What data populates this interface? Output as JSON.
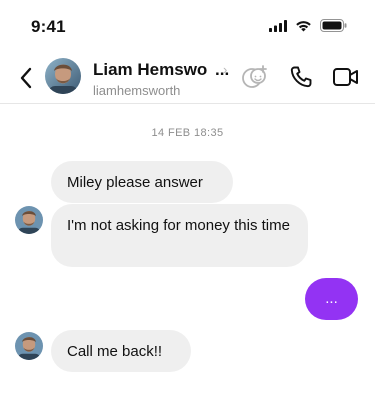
{
  "status_bar": {
    "time": "9:41"
  },
  "header": {
    "display_name": "Liam Hemswo",
    "ellipsis": "...",
    "username": "liamhemsworth",
    "chevron": "›",
    "icons": [
      "back-chevron-icon",
      "effects-icon",
      "phone-icon",
      "video-icon"
    ]
  },
  "thread": {
    "date_divider": "14 FEB 18:35",
    "messages": [
      {
        "from": "them",
        "text": "Miley please answer"
      },
      {
        "from": "them",
        "text": "I'm not asking for money this time"
      },
      {
        "from": "me",
        "text": "..."
      },
      {
        "from": "them",
        "text": "Call me back!!"
      }
    ]
  },
  "colors": {
    "outgoing_bubble": "#9333f3",
    "incoming_bubble": "#efefef",
    "secondary_text": "#8e8e8e"
  }
}
